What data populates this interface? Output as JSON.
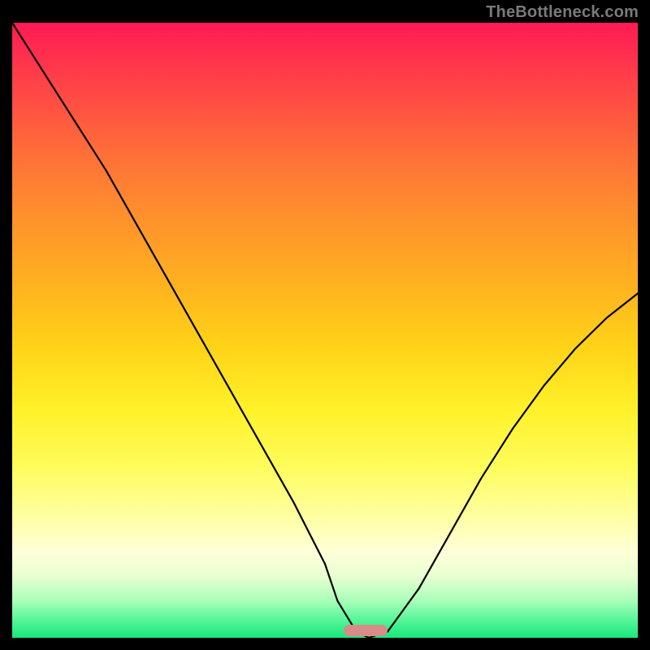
{
  "watermark": "TheBottleneck.com",
  "chart_data": {
    "type": "line",
    "title": "",
    "xlabel": "",
    "ylabel": "",
    "x_range": [
      0,
      100
    ],
    "y_range": [
      0,
      100
    ],
    "grid": false,
    "legend": false,
    "background_gradient": {
      "direction": "vertical",
      "stops": [
        {
          "pos": 0.0,
          "color": "#ff1a54"
        },
        {
          "pos": 0.3,
          "color": "#ff8c2e"
        },
        {
          "pos": 0.63,
          "color": "#fff12a"
        },
        {
          "pos": 0.86,
          "color": "#ffffd8"
        },
        {
          "pos": 1.0,
          "color": "#18e879"
        }
      ]
    },
    "series": [
      {
        "name": "bottleneck-curve",
        "x": [
          0,
          5,
          10,
          15,
          20,
          25,
          30,
          35,
          40,
          45,
          50,
          52,
          55,
          57,
          60,
          65,
          70,
          75,
          80,
          85,
          90,
          95,
          100
        ],
        "y": [
          100,
          92,
          84,
          76,
          67,
          58,
          49,
          40,
          31,
          22,
          12,
          6,
          1,
          0,
          1,
          8,
          17,
          26,
          34,
          41,
          47,
          52,
          56
        ]
      }
    ],
    "marker": {
      "name": "optimal-range",
      "x_start": 53,
      "x_end": 60,
      "y": 0,
      "color": "#d98b87"
    }
  }
}
